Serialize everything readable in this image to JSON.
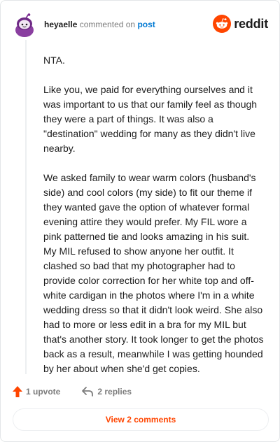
{
  "header": {
    "username": "heyaelle",
    "action": "commented on",
    "target": "post",
    "brand": "reddit"
  },
  "comment": {
    "paragraphs": [
      "NTA.",
      "Like you, we paid for everything ourselves and it was important to us that our family feel as though they were a part of things. It was also a \"destination\" wedding for many as they didn't live nearby.",
      "We asked family to wear warm colors (husband's side) and cool colors (my side) to fit our theme if they wanted gave the option of whatever formal evening attire they would prefer. My FIL wore a pink patterned tie and looks amazing in his suit. My MIL refused to show anyone her outfit. It clashed so bad that my photographer had to provide color correction for her white top and off-white cardigan in the photos where I'm in a white wedding dress so that it didn't look weird. She also had to more or less edit in a bra for my MIL but that's another story. It took longer to get the photos back as a result, meanwhile I was getting hounded by her about when she'd get copies."
    ]
  },
  "actions": {
    "upvote_label": "1 upvote",
    "replies_label": "2 replies",
    "view_comments_label": "View 2 comments"
  },
  "icons": {
    "avatar": "snoo-avatar-icon",
    "brand": "reddit-logo-icon",
    "upvote": "upvote-arrow-icon",
    "reply": "reply-arrow-icon"
  },
  "colors": {
    "brand_orange": "#ff4500",
    "link_blue": "#0079d3",
    "muted": "#7c7c7c",
    "avatar_purple": "#8a3fa0"
  }
}
